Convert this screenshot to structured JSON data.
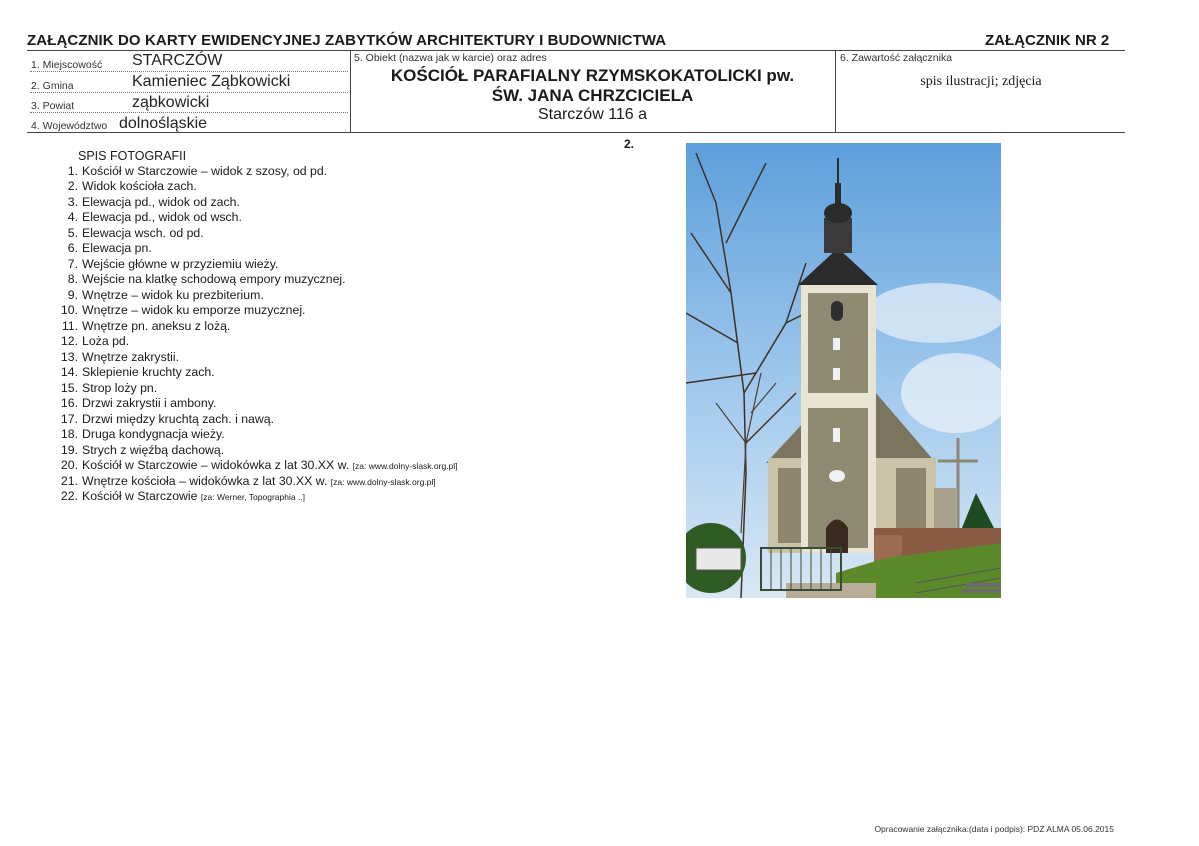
{
  "header": {
    "title": "ZAŁĄCZNIK DO KARTY EWIDENCYJNEJ ZABYTKÓW ARCHITEKTURY I BUDOWNICTWA",
    "attachment_no": "ZAŁĄCZNIK NR 2"
  },
  "fields": {
    "miejscowosc_label": "1. Miejscowość",
    "miejscowosc_value": "STARCZÓW",
    "gmina_label": "2. Gmina",
    "gmina_value": "Kamieniec Ząbkowicki",
    "powiat_label": "3. Powiat",
    "powiat_value": "ząbkowicki",
    "wojewodztwo_label": "4. Województwo",
    "wojewodztwo_value": "dolnośląskie"
  },
  "object": {
    "label": "5. Obiekt (nazwa jak w karcie) oraz adres",
    "name_line1": "KOŚCIÓŁ PARAFIALNY RZYMSKOKATOLICKI pw.",
    "name_line2": "ŚW. JANA CHRZCICIELA",
    "address": "Starczów 116 a"
  },
  "content": {
    "label": "6. Zawartość załącznika",
    "value": "spis ilustracji; zdjęcia"
  },
  "photo_list": {
    "title": "SPIS FOTOGRAFII",
    "items": [
      {
        "n": "1.",
        "text": "Kościół w Starczowie – widok z szosy, od pd.",
        "src": ""
      },
      {
        "n": "2.",
        "text": "Widok kościoła zach.",
        "src": ""
      },
      {
        "n": "3.",
        "text": "Elewacja pd., widok od zach.",
        "src": ""
      },
      {
        "n": "4.",
        "text": "Elewacja pd., widok od wsch.",
        "src": ""
      },
      {
        "n": "5.",
        "text": "Elewacja wsch. od pd.",
        "src": ""
      },
      {
        "n": "6.",
        "text": "Elewacja pn.",
        "src": ""
      },
      {
        "n": "7.",
        "text": "Wejście główne w przyziemiu wieży.",
        "src": ""
      },
      {
        "n": "8.",
        "text": "Wejście na klatkę schodową empory muzycznej.",
        "src": ""
      },
      {
        "n": "9.",
        "text": "Wnętrze – widok ku prezbiterium.",
        "src": ""
      },
      {
        "n": "10.",
        "text": "Wnętrze – widok ku emporze muzycznej.",
        "src": ""
      },
      {
        "n": "11.",
        "text": "Wnętrze pn. aneksu z lożą.",
        "src": ""
      },
      {
        "n": "12.",
        "text": "Loża pd.",
        "src": ""
      },
      {
        "n": "13.",
        "text": "Wnętrze zakrystii.",
        "src": ""
      },
      {
        "n": "14.",
        "text": "Sklepienie kruchty zach.",
        "src": ""
      },
      {
        "n": "15.",
        "text": "Strop loży pn.",
        "src": ""
      },
      {
        "n": "16.",
        "text": "Drzwi zakrystii i ambony.",
        "src": ""
      },
      {
        "n": "17.",
        "text": "Drzwi między kruchtą zach. i nawą.",
        "src": ""
      },
      {
        "n": "18.",
        "text": "Druga kondygnacja wieży.",
        "src": ""
      },
      {
        "n": "19.",
        "text": "Strych z więźbą dachową.",
        "src": ""
      },
      {
        "n": "20.",
        "text": "Kościół w Starczowie – widokówka z lat 30.XX w. ",
        "src": "[za: www.dolny-slask.org.pl]"
      },
      {
        "n": "21.",
        "text": "Wnętrze kościoła – widokówka z lat 30.XX w. ",
        "src": "[za: www.dolny-slask.org.pl]"
      },
      {
        "n": "22.",
        "text": "Kościół w Starczowie ",
        "src": "[za: Werner, Topographia ..]"
      }
    ]
  },
  "photo": {
    "number": "2."
  },
  "footer": {
    "text": "Opracowanie załącznika:(data i podpis): PDZ ALMA 05.06.2015"
  }
}
